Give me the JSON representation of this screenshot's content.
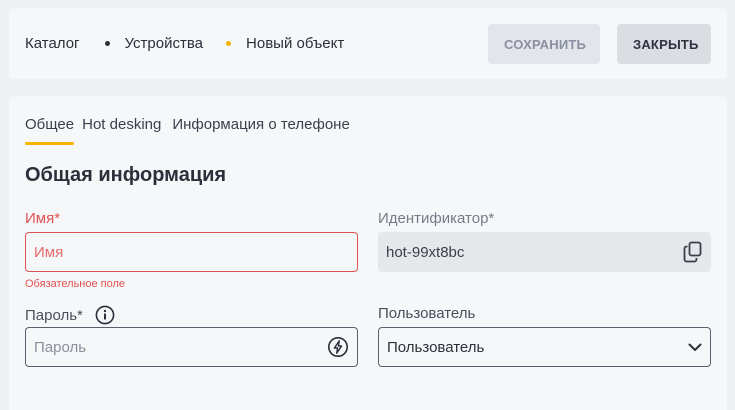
{
  "breadcrumb": {
    "items": [
      "Каталог",
      "Устройства",
      "Новый объект"
    ]
  },
  "actions": {
    "save_label": "СОХРАНИТЬ",
    "close_label": "ЗАКРЫТЬ"
  },
  "tabs": [
    {
      "label": "Общее",
      "active": true
    },
    {
      "label": "Hot desking",
      "active": false
    },
    {
      "label": "Информация о телефоне",
      "active": false
    }
  ],
  "section": {
    "title": "Общая информация"
  },
  "form": {
    "name": {
      "label": "Имя*",
      "placeholder": "Имя",
      "error": "Обязательное поле"
    },
    "identifier": {
      "label": "Идентификатор*",
      "value": "hot-99xt8bc"
    },
    "password": {
      "label": "Пароль*",
      "placeholder": "Пароль"
    },
    "user": {
      "label": "Пользователь",
      "selected": "Пользователь"
    }
  },
  "colors": {
    "accent": "#f5b400",
    "error": "#e05252",
    "background": "#eef0f3",
    "card": "#f6f7f9"
  },
  "icons": [
    "copy-icon",
    "info-icon",
    "generate-password-icon",
    "chevron-down-icon"
  ]
}
